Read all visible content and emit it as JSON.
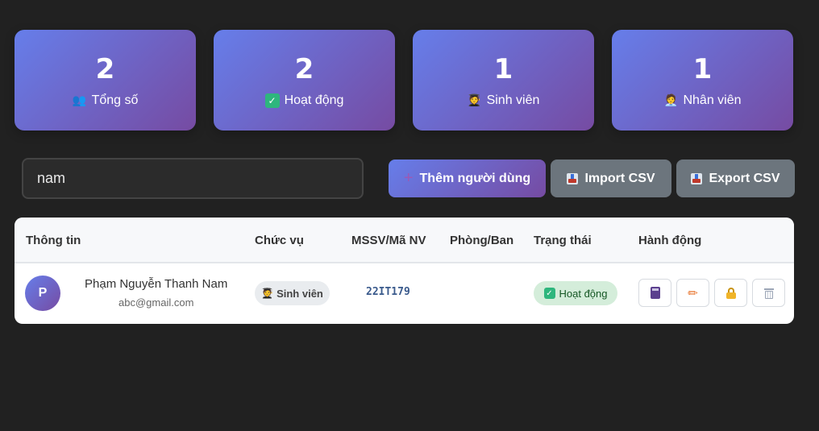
{
  "stats": [
    {
      "value": "2",
      "label": "Tổng số",
      "icon": "users-icon"
    },
    {
      "value": "2",
      "label": "Hoạt động",
      "icon": "check-icon"
    },
    {
      "value": "1",
      "label": "Sinh viên",
      "icon": "student-icon"
    },
    {
      "value": "1",
      "label": "Nhân viên",
      "icon": "staff-icon"
    }
  ],
  "search": {
    "value": "nam"
  },
  "toolbar": {
    "add_label": "Thêm người dùng",
    "import_label": "Import CSV",
    "export_label": "Export CSV"
  },
  "table": {
    "headers": [
      "Thông tin",
      "Chức vụ",
      "MSSV/Mã NV",
      "Phòng/Ban",
      "Trạng thái",
      "Hành động"
    ],
    "rows": [
      {
        "avatar": "P",
        "name": "Phạm Nguyễn Thanh Nam",
        "email": "abc@gmail.com",
        "role": "Sinh viên",
        "code": "22IT179",
        "department": "",
        "status": "Hoạt động"
      }
    ]
  },
  "colors": {
    "background": "#212121",
    "gradient_start": "#667eea",
    "gradient_end": "#764ba2",
    "button_gray": "#6c757d",
    "status_bg": "#d4edda",
    "status_text": "#155724"
  }
}
